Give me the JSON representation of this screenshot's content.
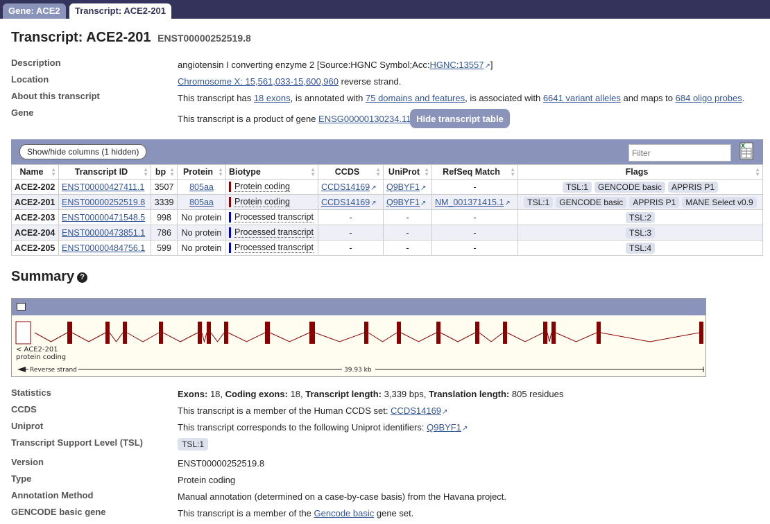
{
  "tabs": {
    "gene": "Gene: ACE2",
    "transcript": "Transcript: ACE2-201"
  },
  "header": {
    "title": "Transcript: ACE2-201",
    "stable_id": "ENST00000252519.8"
  },
  "info": {
    "description_label": "Description",
    "description_text": "angiotensin I converting enzyme 2 [Source:HGNC Symbol;Acc:",
    "description_link": "HGNC:13557",
    "description_end": "]",
    "location_label": "Location",
    "location_link": "Chromosome X: 15,561,033-15,600,960",
    "location_text": " reverse strand.",
    "about_label": "About this transcript",
    "about_pre": "This transcript has ",
    "about_exons": "18 exons",
    "about_mid1": ", is annotated with ",
    "about_domains": "75 domains and features",
    "about_mid2": ", is associated with ",
    "about_variants": "6641 variant alleles",
    "about_mid3": " and maps to ",
    "about_probes": "684 oligo probes",
    "about_end": ".",
    "gene_label": "Gene",
    "gene_pre": "This transcript is a product of gene ",
    "gene_link": "ENSG00000130234.11",
    "hide_button": "Hide transcript table"
  },
  "table": {
    "show_hide": "Show/hide columns (1 hidden)",
    "filter_placeholder": "Filter",
    "columns": [
      "Name",
      "Transcript ID",
      "bp",
      "Protein",
      "Biotype",
      "CCDS",
      "UniProt",
      "RefSeq Match",
      "Flags"
    ],
    "rows": [
      {
        "name": "ACE2-202",
        "id": "ENST00000427411.1",
        "bp": "3507",
        "protein": "805aa",
        "biotype": "Protein coding",
        "ccds": "CCDS14169",
        "uniprot": "Q9BYF1",
        "refseq": "-",
        "flags": [
          "TSL:1",
          "GENCODE basic",
          "APPRIS P1"
        ]
      },
      {
        "name": "ACE2-201",
        "id": "ENST00000252519.8",
        "bp": "3339",
        "protein": "805aa",
        "biotype": "Protein coding",
        "ccds": "CCDS14169",
        "uniprot": "Q9BYF1",
        "refseq": "NM_001371415.1",
        "flags": [
          "TSL:1",
          "GENCODE basic",
          "APPRIS P1",
          "MANE Select v0.9"
        ]
      },
      {
        "name": "ACE2-203",
        "id": "ENST00000471548.5",
        "bp": "998",
        "protein": "No protein",
        "biotype": "Processed transcript",
        "ccds": "-",
        "uniprot": "-",
        "refseq": "-",
        "flags": [
          "TSL:2"
        ]
      },
      {
        "name": "ACE2-204",
        "id": "ENST00000473851.1",
        "bp": "786",
        "protein": "No protein",
        "biotype": "Processed transcript",
        "ccds": "-",
        "uniprot": "-",
        "refseq": "-",
        "flags": [
          "TSL:3"
        ]
      },
      {
        "name": "ACE2-205",
        "id": "ENST00000484756.1",
        "bp": "599",
        "protein": "No protein",
        "biotype": "Processed transcript",
        "ccds": "-",
        "uniprot": "-",
        "refseq": "-",
        "flags": [
          "TSL:4"
        ]
      }
    ]
  },
  "summary": {
    "title": "Summary",
    "help": "?",
    "viz_label1": "< ACE2-201",
    "viz_label2": "protein coding",
    "strand": "Reverse strand",
    "length": "39.93 kb"
  },
  "details": {
    "stats_label": "Statistics",
    "stats_exons_k": "Exons:",
    "stats_exons_v": " 18, ",
    "stats_coding_k": "Coding exons:",
    "stats_coding_v": " 18, ",
    "stats_len_k": "Transcript length:",
    "stats_len_v": " 3,339 bps, ",
    "stats_tl_k": "Translation length:",
    "stats_tl_v": " 805 residues",
    "ccds_label": "CCDS",
    "ccds_pre": "This transcript is a member of the Human CCDS set: ",
    "ccds_link": "CCDS14169",
    "uniprot_label": "Uniprot",
    "uniprot_pre": "This transcript corresponds to the following Uniprot identifiers: ",
    "uniprot_link": "Q9BYF1",
    "tsl_label": "Transcript Support Level (TSL)",
    "tsl_value": "TSL:1",
    "version_label": "Version",
    "version_value": "ENST00000252519.8",
    "type_label": "Type",
    "type_value": "Protein coding",
    "method_label": "Annotation Method",
    "method_value": "Manual annotation (determined on a case-by-case basis) from the Havana project.",
    "gencode_label": "GENCODE basic gene",
    "gencode_pre": "This transcript is a member of the ",
    "gencode_link": "Gencode basic",
    "gencode_end": " gene set."
  },
  "colors": {
    "coding": "#8b0000",
    "processed": "#0000cc",
    "accent": "#8a93ba",
    "tab_bar": "#33335c"
  }
}
